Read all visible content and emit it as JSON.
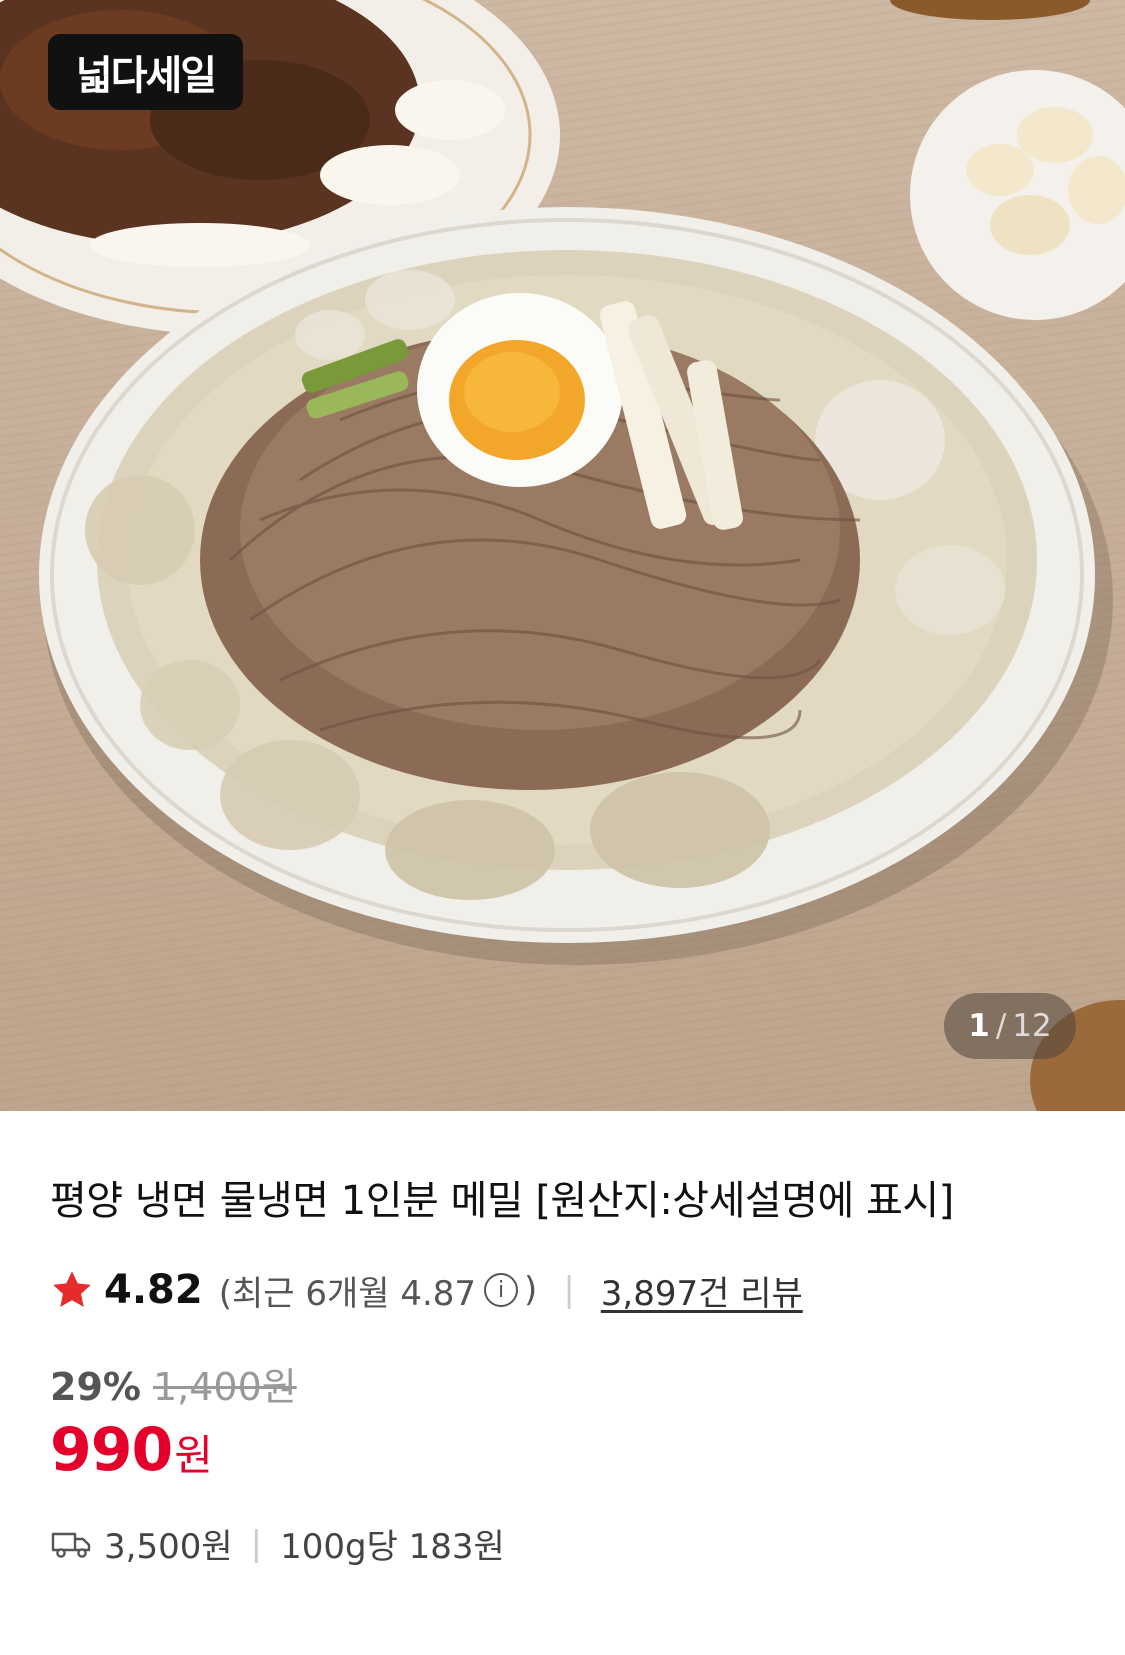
{
  "hero": {
    "badge": "넓다세일",
    "counter": {
      "current": "1",
      "separator": "/",
      "total": "12"
    }
  },
  "product": {
    "title": "평양 냉면 물냉면 1인분 메밀 [원산지:상세설명에 표시]",
    "rating": "4.82",
    "recent_rating": "(최근 6개월 4.87",
    "recent_close": ")",
    "review_count": "3,897건 리뷰",
    "discount": "29%",
    "original_price": "1,400원",
    "price": "990",
    "price_unit": "원",
    "shipping_fee": "3,500원",
    "unit_price": "100g당 183원"
  },
  "colors": {
    "accent": "#e4002b",
    "star": "#e52b2b"
  },
  "icons": [
    "star-icon",
    "info-icon",
    "truck-icon"
  ]
}
